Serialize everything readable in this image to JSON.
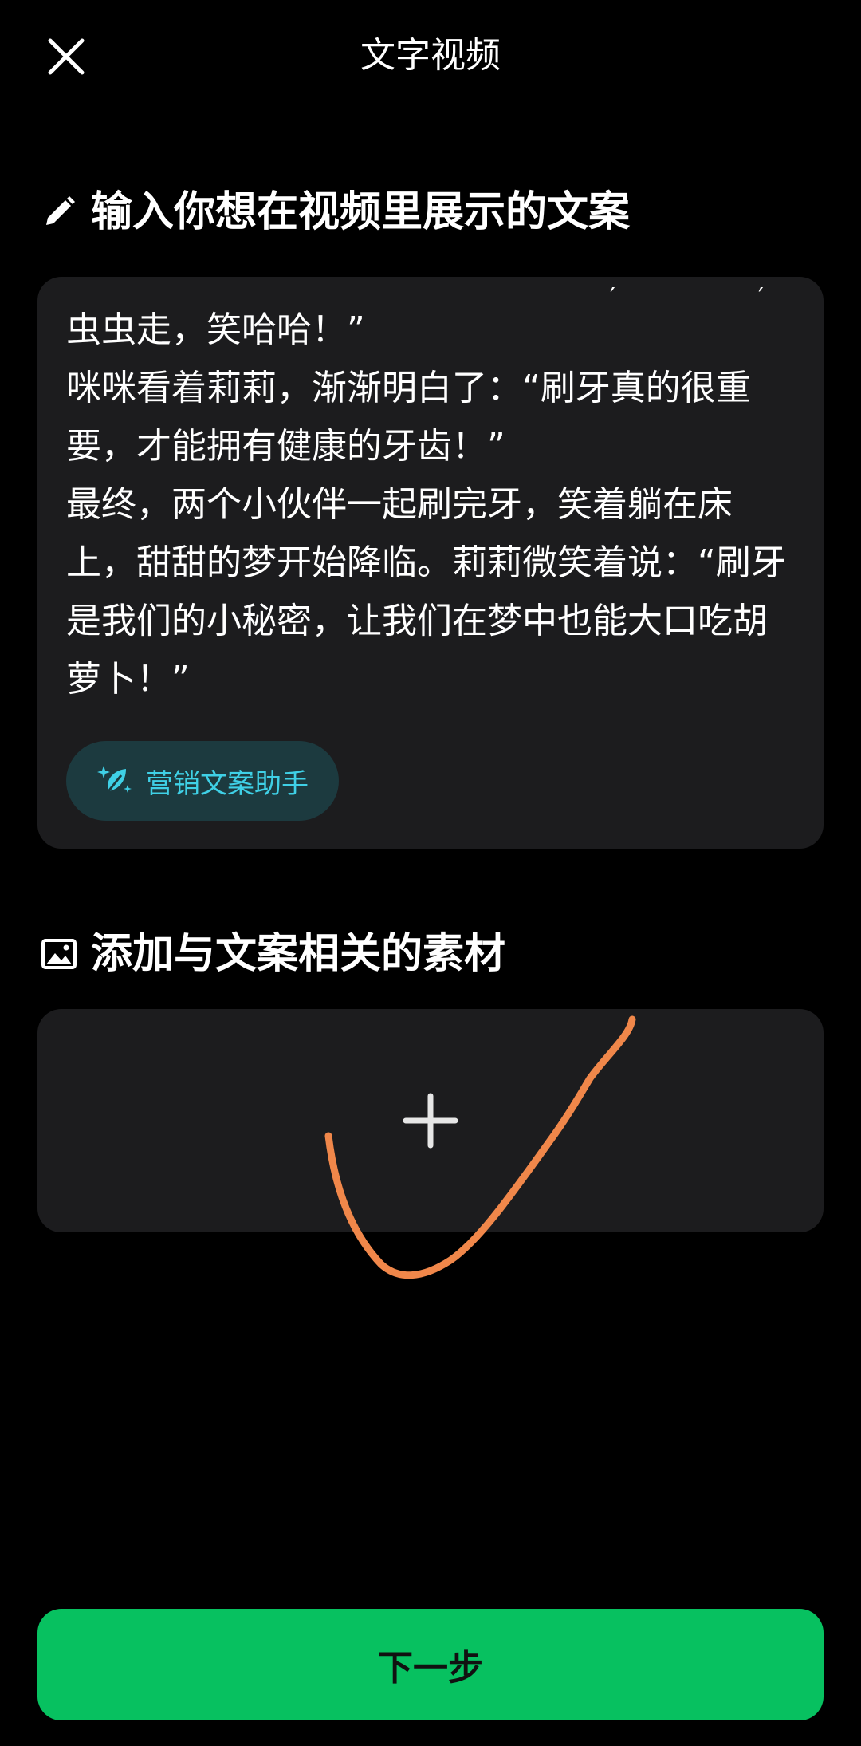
{
  "header": {
    "title": "文字视频",
    "close_icon": "close-icon"
  },
  "section_text": {
    "title": "输入你想在视频里展示的文案",
    "icon": "pencil-icon"
  },
  "script": {
    "text": "虫虫走，笑哈哈！”\n咪咪看着莉莉，渐渐明白了：“刷牙真的很重要，才能拥有健康的牙齿！”\n最终，两个小伙伴一起刷完牙，笑着躺在床上，甜甜的梦开始降临。莉莉微笑着说：“刷牙是我们的小秘密，让我们在梦中也能大口吃胡萝卜！”"
  },
  "assistant_button": {
    "label": "营销文案助手",
    "icon": "sparkle-leaf-icon",
    "color": "#3fd0e6"
  },
  "section_media": {
    "title": "添加与文案相关的素材",
    "icon": "image-icon"
  },
  "media_picker": {
    "icon": "plus-icon"
  },
  "footer": {
    "next_label": "下一步",
    "color": "#07c160"
  },
  "colors": {
    "background": "#000000",
    "card": "#1c1c1e",
    "annotation": "#f0874a"
  }
}
